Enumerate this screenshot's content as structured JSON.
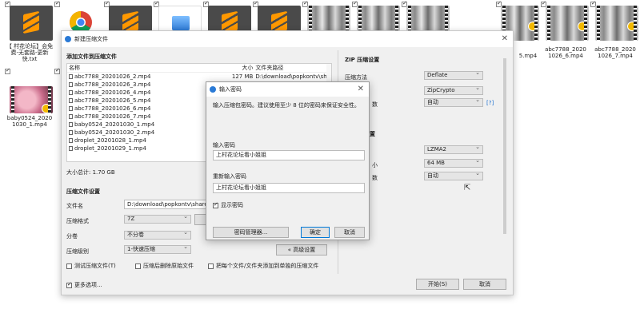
{
  "desktop": {
    "items": [
      {
        "label": "【 村花论坛】会免费-无套路-更新快.txt",
        "checked": true,
        "icon": "sublime-text-icon"
      },
      {
        "label": "",
        "checked": true,
        "icon": "chrome-icon"
      },
      {
        "label": "",
        "checked": true,
        "icon": "sublime-text-icon"
      },
      {
        "label": "",
        "checked": true,
        "icon": "image-file-icon"
      },
      {
        "label": "",
        "checked": true,
        "icon": "sublime-text-icon"
      },
      {
        "label": "",
        "checked": true,
        "icon": "sublime-text-icon"
      },
      {
        "label": "",
        "checked": true,
        "icon": "video-thumbnail"
      },
      {
        "label": "",
        "checked": true,
        "icon": "video-thumbnail"
      },
      {
        "label": "",
        "checked": true,
        "icon": "video-thumbnail"
      },
      {
        "label": "5.mp4",
        "checked": true,
        "icon": "video-thumbnail"
      },
      {
        "label": "abc7788_2020 1026_6.mp4",
        "checked": true,
        "icon": "video-thumbnail"
      },
      {
        "label": "abc7788_2020 1026_7.mp4",
        "checked": true,
        "icon": "video-thumbnail"
      },
      {
        "label": "baby0524_2020 1030_1.mp4",
        "checked": true,
        "icon": "video-thumbnail"
      }
    ]
  },
  "dialog": {
    "title": "新建压缩文件",
    "add_files_heading": "添加文件到压缩文件",
    "list_headers": {
      "name": "名称",
      "size": "大小",
      "path": "文件夹路径"
    },
    "files": [
      {
        "name": "abc7788_20201026_2.mp4",
        "size": "127 MB",
        "path": "D:\\download\\popkontv\\share\\pa"
      },
      {
        "name": "abc7788_20201026_3.mp4",
        "size": "",
        "path": ""
      },
      {
        "name": "abc7788_20201026_4.mp4",
        "size": "",
        "path": ""
      },
      {
        "name": "abc7788_20201026_5.mp4",
        "size": "",
        "path": ""
      },
      {
        "name": "abc7788_20201026_6.mp4",
        "size": "",
        "path": ""
      },
      {
        "name": "abc7788_20201026_7.mp4",
        "size": "",
        "path": ""
      },
      {
        "name": "baby0524_20201030_1.mp4",
        "size": "",
        "path": ""
      },
      {
        "name": "baby0524_20201030_2.mp4",
        "size": "",
        "path": ""
      },
      {
        "name": "droplet_20201028_1.mp4",
        "size": "",
        "path": ""
      },
      {
        "name": "droplet_20201029_1.mp4",
        "size": "",
        "path": ""
      }
    ],
    "total_size": "大小总计: 1.70 GB",
    "compress_settings_heading": "压缩文件设置",
    "filename_label": "文件名",
    "filename_value": "D:\\download\\popkontv\\share\\pa",
    "format_label": "压缩格式",
    "format_value": "7Z",
    "volume_label": "分卷",
    "volume_value": "不分卷",
    "level_label": "压缩级别",
    "level_value": "1-快速压缩",
    "advanced_button": "« 高级设置",
    "test_after_label": "测试压缩文件(T)",
    "delete_after_label": "压缩后删除原始文件",
    "separate_label": "把每个文件/文件夹添加到单独的压缩文件",
    "more_options_label": "更多选项...",
    "start_button": "开始(S)",
    "cancel_button": "取消",
    "zip_heading": "ZIP 压缩设置",
    "zip_method_label": "压缩方法",
    "zip_method_value": "Deflate",
    "zip_encryption_value": "ZipCrypto",
    "zip_threads_label": "数",
    "zip_threads_value": "自动",
    "help_link": "[?]",
    "sevenzip_heading_tail": "置",
    "sevenzip_method_value": "LZMA2",
    "dict_label_tail": "小",
    "dict_value": "64 MB",
    "threads2_label_tail": "数",
    "threads2_value": "自动"
  },
  "password_dialog": {
    "title": "输入密码",
    "instruction": "输入压缩包密码。建议使用至少 8 位的密码来保证安全性。",
    "password_label": "输入密码",
    "password_value": "上村花论坛看小姐姐",
    "confirm_label": "重新输入密码",
    "confirm_value": "上村花论坛看小姐姐",
    "show_password_label": "显示密码",
    "show_password_checked": true,
    "manager_button": "密码管理器...",
    "ok_button": "确定",
    "cancel_button": "取消"
  }
}
